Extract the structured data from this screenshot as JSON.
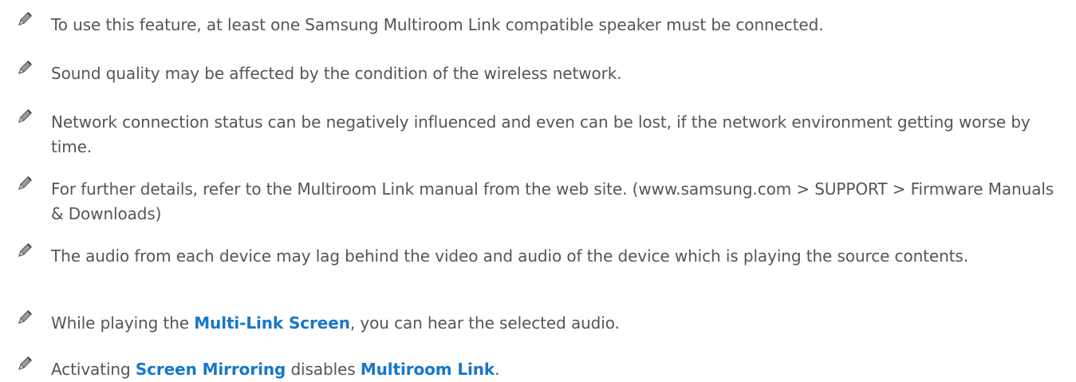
{
  "icon": "pencil-note-icon",
  "colors": {
    "text": "#555555",
    "highlight": "#1877c8",
    "icon": "#666666"
  },
  "notes": [
    {
      "segments": [
        {
          "text": "To use this feature, at least one Samsung Multiroom Link compatible speaker must be connected."
        }
      ]
    },
    {
      "segments": [
        {
          "text": "Sound quality may be affected by the condition of the wireless network."
        }
      ]
    },
    {
      "segments": [
        {
          "text": "Network connection status can be negatively influenced and even can be lost, if the network environment getting worse by time."
        }
      ]
    },
    {
      "segments": [
        {
          "text": "For further details, refer to the Multiroom Link manual from the web site. (www.samsung.com > SUPPORT > Firmware Manuals & Downloads)"
        }
      ]
    },
    {
      "segments": [
        {
          "text": "The audio from each device may lag behind the video and audio of the device which is playing the source contents."
        }
      ]
    },
    {
      "segments": [
        {
          "text": "While playing the "
        },
        {
          "text": "Multi-Link Screen",
          "highlight": true
        },
        {
          "text": ", you can hear the selected audio."
        }
      ]
    },
    {
      "segments": [
        {
          "text": "Activating "
        },
        {
          "text": "Screen Mirroring",
          "highlight": true
        },
        {
          "text": " disables "
        },
        {
          "text": "Multiroom Link",
          "highlight": true
        },
        {
          "text": "."
        }
      ]
    }
  ]
}
